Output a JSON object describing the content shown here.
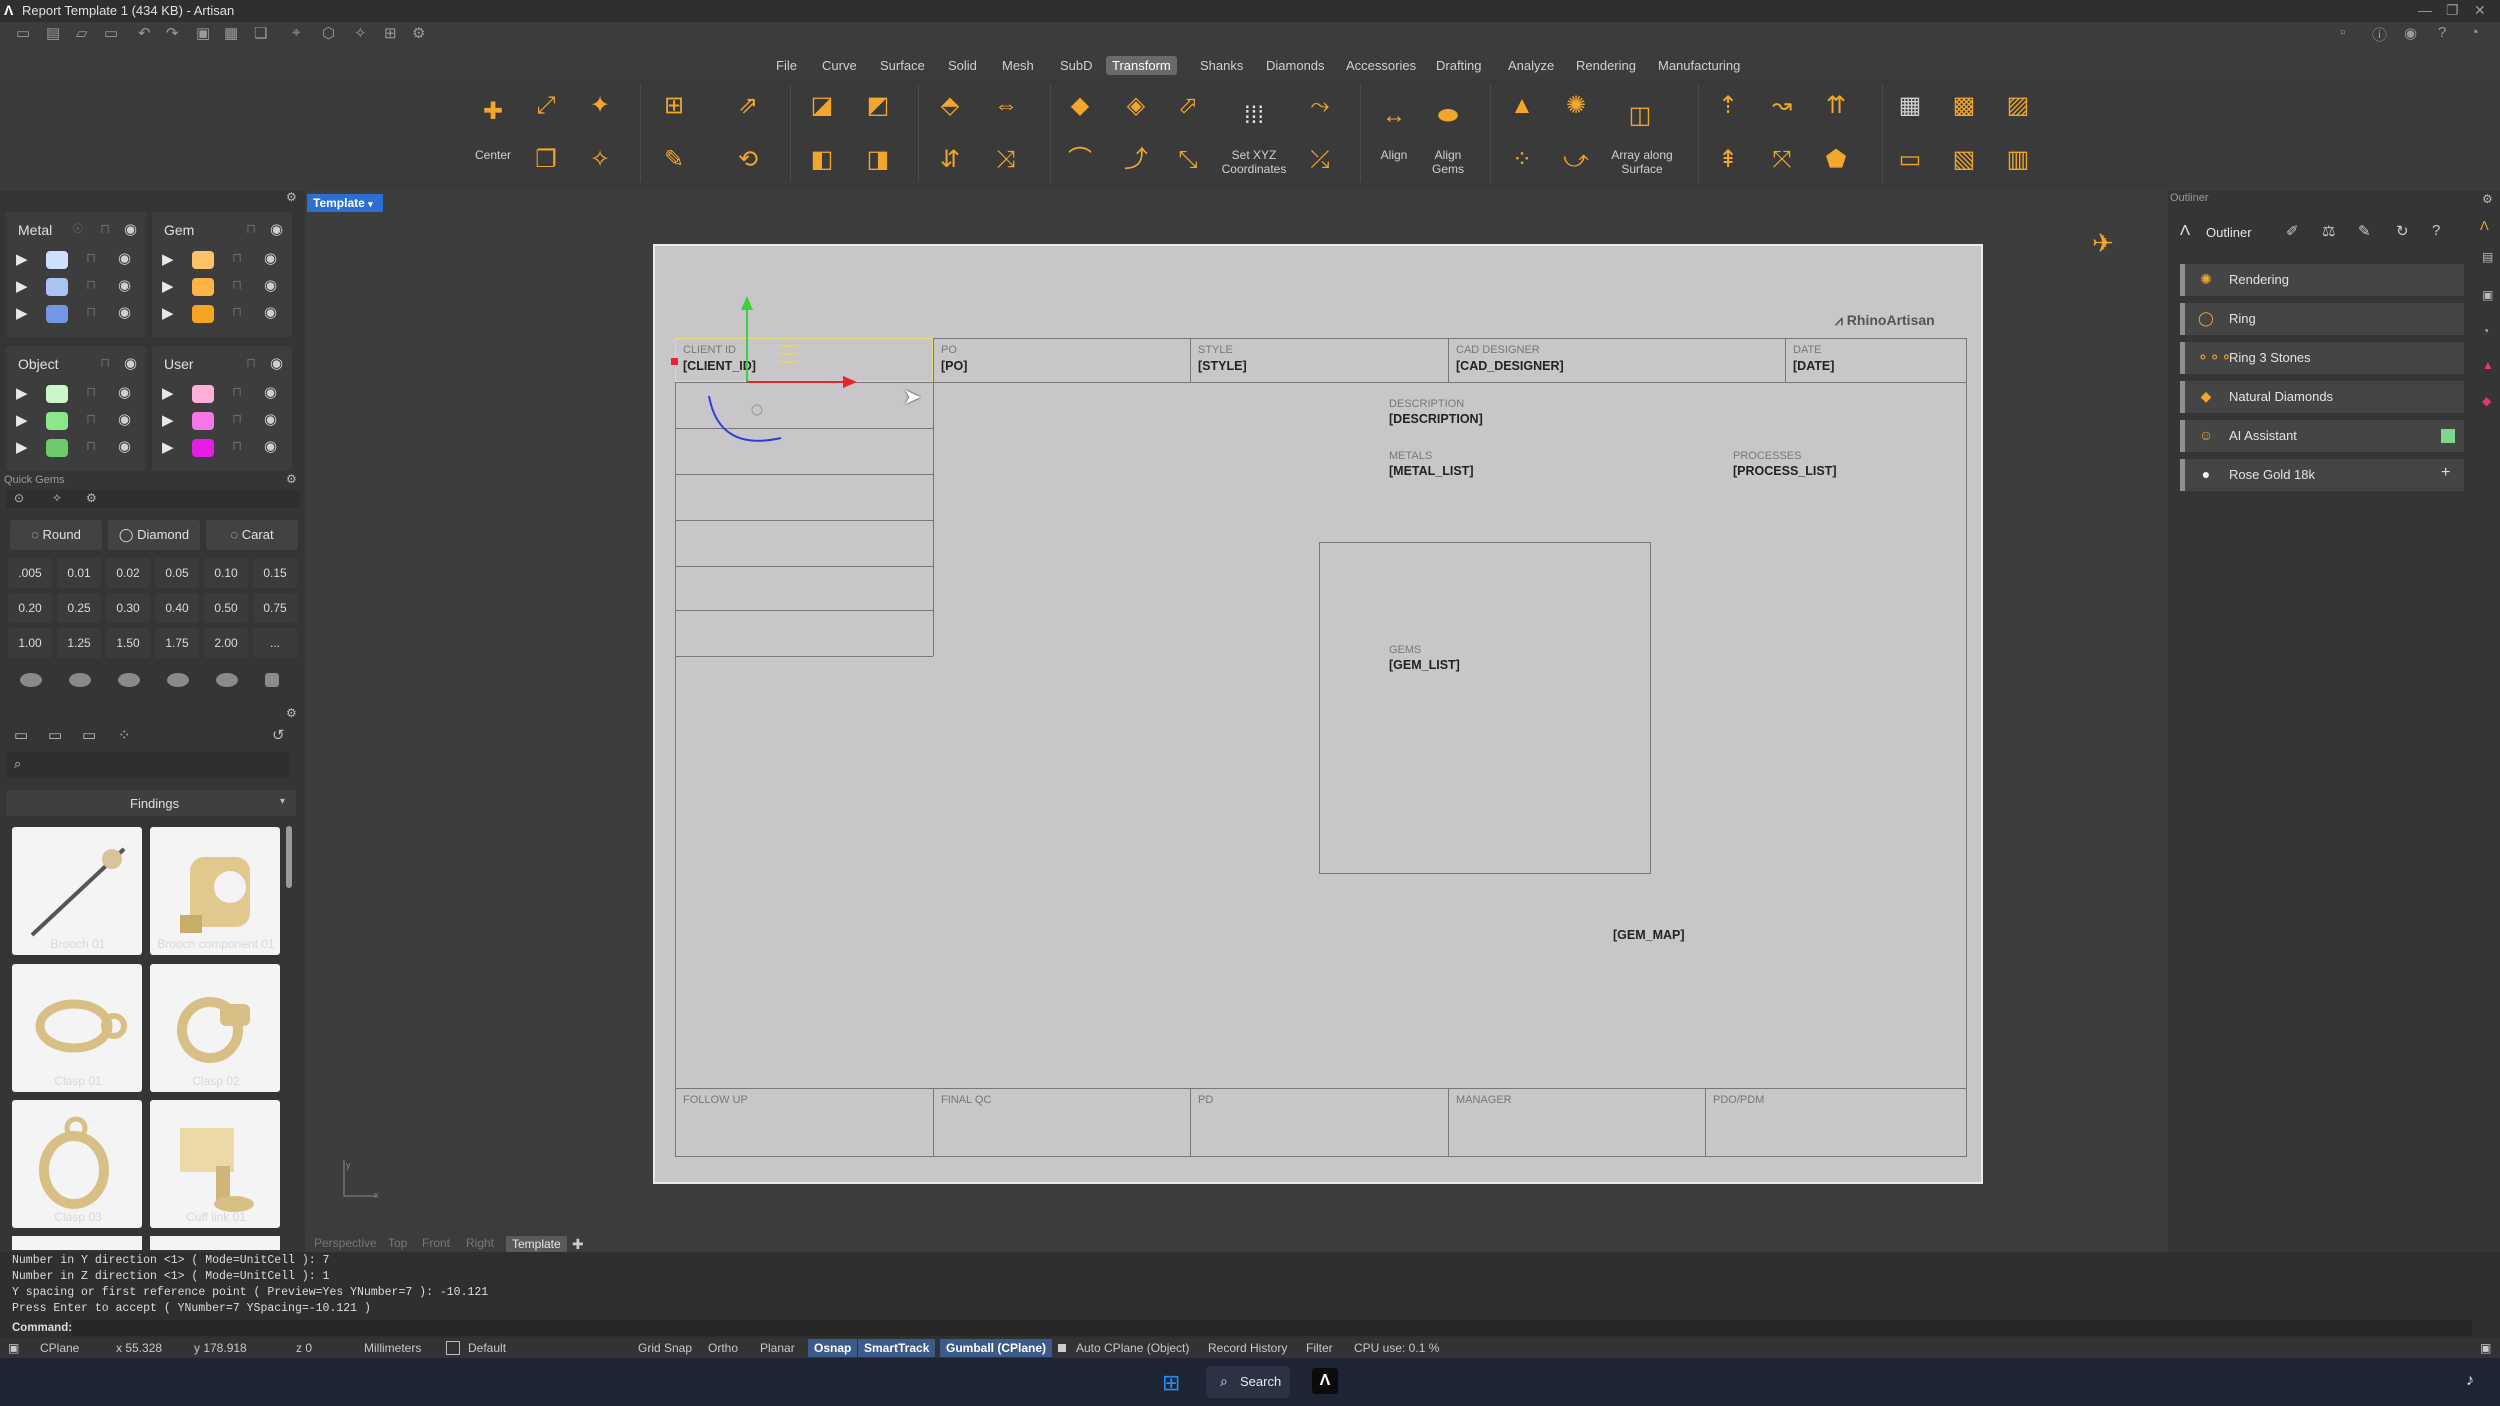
{
  "app": {
    "title": "Report Template 1 (434 KB) - Artisan"
  },
  "menu": {
    "items": [
      "File",
      "Curve",
      "Surface",
      "Solid",
      "Mesh",
      "SubD",
      "Transform",
      "Shanks",
      "Diamonds",
      "Accessories",
      "Drafting",
      "Analyze",
      "Rendering",
      "Manufacturing"
    ],
    "active": "Transform"
  },
  "ribbon": {
    "center": "Center",
    "set_xyz": "Set XYZ\nCoordinates",
    "align": "Align",
    "align_gems": "Align\nGems",
    "array_surface": "Array along\nSurface"
  },
  "layers": {
    "metal": {
      "label": "Metal",
      "colors": [
        "#cfe0ff",
        "#a9c3f5",
        "#7396e6"
      ]
    },
    "gem": {
      "label": "Gem",
      "colors": [
        "#ffc26a",
        "#ffb347",
        "#f7a520"
      ]
    },
    "object": {
      "label": "Object",
      "colors": [
        "#c9f7c9",
        "#8ae88a",
        "#6ccb6c"
      ]
    },
    "user": {
      "label": "User",
      "colors": [
        "#ffb0d9",
        "#f577e6",
        "#e51ee5"
      ]
    }
  },
  "quick_gems": {
    "title": "Quick Gems",
    "buttons": [
      "Round",
      "Diamond",
      "Carat"
    ],
    "sizes": [
      ".005",
      "0.01",
      "0.02",
      "0.05",
      "0.10",
      "0.15",
      "0.20",
      "0.25",
      "0.30",
      "0.40",
      "0.50",
      "0.75",
      "1.00",
      "1.25",
      "1.50",
      "1.75",
      "2.00",
      "..."
    ]
  },
  "library": {
    "category": "Findings",
    "items": [
      "Brooch 01",
      "Brooch component 01",
      "Clasp 01",
      "Clasp 02",
      "Clasp 03",
      "Cuff link 01"
    ]
  },
  "viewport": {
    "tab": "Template",
    "views": [
      "Perspective",
      "Top",
      "Front",
      "Right",
      "Template"
    ],
    "active_view": "Template"
  },
  "report": {
    "brand": "RhinoArtisan",
    "header": [
      {
        "label": "CLIENT ID",
        "value": "[CLIENT_ID]"
      },
      {
        "label": "PO",
        "value": "[PO]"
      },
      {
        "label": "STYLE",
        "value": "[STYLE]"
      },
      {
        "label": "CAD DESIGNER",
        "value": "[CAD_DESIGNER]"
      },
      {
        "label": "DATE",
        "value": "[DATE]"
      }
    ],
    "description": {
      "label": "DESCRIPTION",
      "value": "[DESCRIPTION]"
    },
    "metals": {
      "label": "METALS",
      "value": "[METAL_LIST]"
    },
    "processes": {
      "label": "PROCESSES",
      "value": "[PROCESS_LIST]"
    },
    "gems": {
      "label": "GEMS",
      "value": "[GEM_LIST]"
    },
    "gem_map": "[GEM_MAP]",
    "footer": [
      "FOLLOW UP",
      "FINAL QC",
      "PD",
      "MANAGER",
      "PDO/PDM"
    ]
  },
  "outliner": {
    "title": "Outliner",
    "panel_label": "Outliner",
    "items": [
      "Rendering",
      "Ring",
      "Ring 3 Stones",
      "Natural Diamonds",
      "AI Assistant",
      "Rose Gold 18k"
    ]
  },
  "command": {
    "history": [
      "Number in Y direction <1> ( Mode=UnitCell ): 7",
      "Number in Z direction <1> ( Mode=UnitCell ): 1",
      "Y spacing or first reference point ( Preview=Yes  YNumber=7 ): -10.121",
      "Press Enter to accept ( YNumber=7  YSpacing=-10.121 )"
    ],
    "prompt": "Command:"
  },
  "status": {
    "cplane": "CPlane",
    "x": "x 55.328",
    "y": "y 178.918",
    "z": "z 0",
    "units": "Millimeters",
    "layer": "Default",
    "grid_snap": "Grid Snap",
    "ortho": "Ortho",
    "planar": "Planar",
    "osnap": "Osnap",
    "smarttrack": "SmartTrack",
    "gumball": "Gumball (CPlane)",
    "auto_cplane": "Auto CPlane (Object)",
    "record_history": "Record History",
    "filter": "Filter",
    "cpu": "CPU use: 0.1 %"
  },
  "taskbar": {
    "search": "Search"
  }
}
